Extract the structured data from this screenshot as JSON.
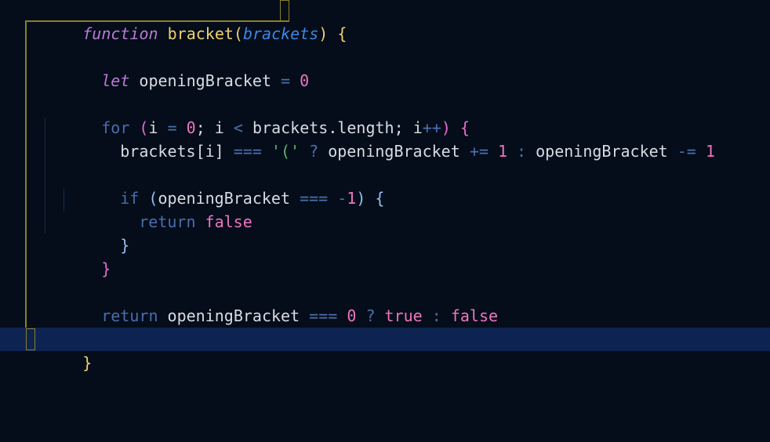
{
  "editor": {
    "line1": {
      "keyword": "function",
      "space1": " ",
      "name": "bracket",
      "lparen": "(",
      "param": "brackets",
      "rparen": ")",
      "space2": " ",
      "brace": "{"
    },
    "line3": {
      "keyword": "let",
      "var": "openingBracket",
      "op": "=",
      "value": "0"
    },
    "line5": {
      "keyword": "for",
      "lparen": "(",
      "i1": "i",
      "op1": "=",
      "zero": "0",
      "semi1": ";",
      "i2": "i",
      "lt": "<",
      "length": "brackets.length",
      "semi2": ";",
      "i3": "i",
      "inc": "++",
      "rparen": ")",
      "brace": "{"
    },
    "line6": {
      "arr": "brackets[i]",
      "eq": "===",
      "str": "'('",
      "q": "?",
      "var1": "openingBracket",
      "pluseq": "+=",
      "one1": "1",
      "colon": ":",
      "var2": "openingBracket",
      "minuseq": "-=",
      "one2": "1"
    },
    "line8": {
      "keyword": "if",
      "lparen": "(",
      "var": "openingBracket",
      "eq": "===",
      "minus": "-",
      "one": "1",
      "rparen": ")",
      "brace": "{"
    },
    "line9": {
      "keyword": "return",
      "value": "false"
    },
    "line10": {
      "brace": "}"
    },
    "line11": {
      "brace": "}"
    },
    "line13": {
      "keyword": "return",
      "var": "openingBracket",
      "eq": "===",
      "zero": "0",
      "q": "?",
      "t": "true",
      "colon": ":",
      "f": "false"
    },
    "line15": {
      "brace": "}"
    }
  },
  "colors": {
    "background": "#040d19",
    "current_line": "#0d2452",
    "keyword_italic": "#b87ad2",
    "keyword_blue": "#4a6dad",
    "function_name": "#f1cf72",
    "parameter": "#3d86e5",
    "number": "#ee74c2",
    "string": "#5fb46c"
  }
}
